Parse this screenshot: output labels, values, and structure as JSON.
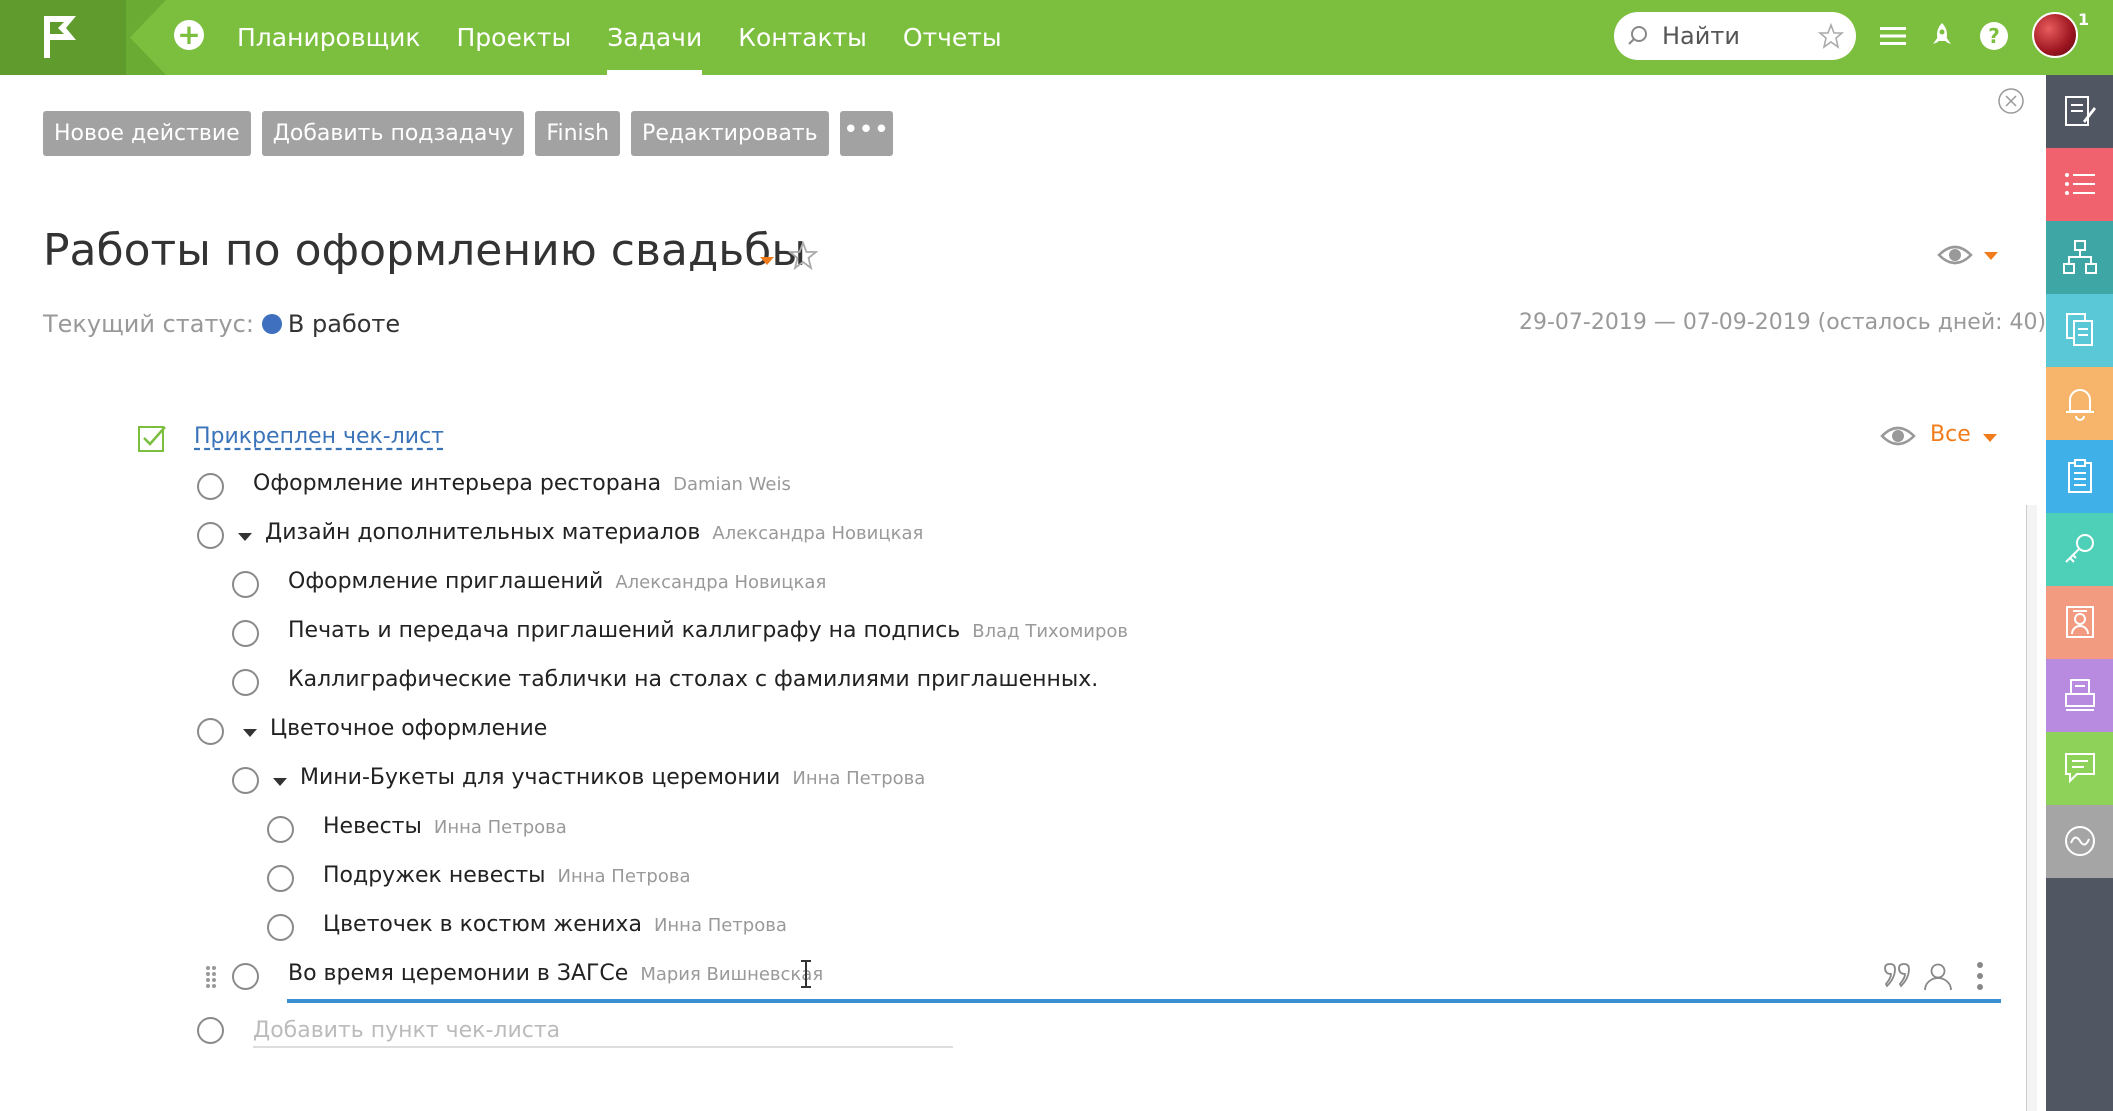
{
  "topbar": {
    "nav": [
      "Планировщик",
      "Проекты",
      "Задачи",
      "Контакты",
      "Отчеты"
    ],
    "active_nav": "Задачи",
    "search_placeholder": "Найти",
    "notification_count": "1",
    "brand_color": "#7cbf3f"
  },
  "toolbar": {
    "new_action": "Новое действие",
    "add_subtask": "Добавить подзадачу",
    "finish": "Finish",
    "edit": "Редактировать",
    "more": "•••"
  },
  "task": {
    "title": "Работы по оформлению свадьбы",
    "status_label": "Текущий статус:",
    "status_value": "В работе",
    "status_color": "#3f6fbf",
    "dates": "29-07-2019 — 07-09-2019 (осталось дней: 40)"
  },
  "checklist": {
    "title": "Прикреплен чек-лист",
    "filter": "Все",
    "add_placeholder": "Добавить пункт чек-листа",
    "items": [
      {
        "text": "Оформление интерьера ресторана",
        "assignee": "Damian Weis"
      },
      {
        "text": "Дизайн дополнительных материалов",
        "assignee": "Александра Новицкая"
      },
      {
        "text": "Оформление приглашений",
        "assignee": "Александра Новицкая"
      },
      {
        "text": "Печать и передача приглашений каллиграфу на подпись",
        "assignee": "Влад Тихомиров"
      },
      {
        "text": "Каллиграфические таблички на столах с фамилиями приглашенных.",
        "assignee": ""
      },
      {
        "text": "Цветочное оформление",
        "assignee": ""
      },
      {
        "text": "Мини-Букеты для участников церемонии",
        "assignee": "Инна Петрова"
      },
      {
        "text": "Невесты",
        "assignee": "Инна Петрова"
      },
      {
        "text": "Подружек невесты",
        "assignee": "Инна Петрова"
      },
      {
        "text": "Цветочек в костюм жениха",
        "assignee": "Инна Петрова"
      },
      {
        "text": "Во время церемонии в ЗАГСе",
        "assignee": "Мария Вишневская"
      }
    ]
  },
  "sidebar": {
    "icons": [
      "edit-doc-icon",
      "list-icon",
      "hierarchy-icon",
      "documents-icon",
      "bell-icon",
      "clipboard-icon",
      "key-icon",
      "contact-card-icon",
      "printer-icon",
      "chat-icon",
      "activity-icon"
    ],
    "colors": [
      "#505662",
      "#f0626e",
      "#3fa6a6",
      "#5bc8d8",
      "#f6b56a",
      "#3fb0e8",
      "#4ed0b8",
      "#f29b80",
      "#b98be0",
      "#8ed25a",
      "#a5a5a5"
    ]
  }
}
